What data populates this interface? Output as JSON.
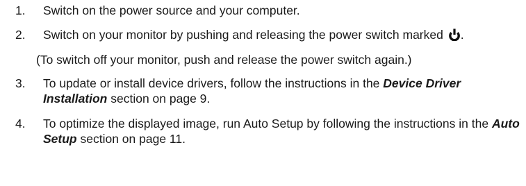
{
  "steps": [
    {
      "number": "1.",
      "text": "Switch on the power source and your computer."
    },
    {
      "number": "2.",
      "text_before_icon": "Switch on your monitor by pushing and releasing the power switch marked",
      "icon": "power-icon",
      "text_after_icon": "."
    },
    {
      "number": "3.",
      "text_before": "To update or install device drivers, follow the instructions in the ",
      "bold_italic": "Device Driver Installation",
      "text_after": " section on page 9."
    },
    {
      "number": "4.",
      "text_before": "To optimize the displayed image, run Auto Setup by following the instructions in the ",
      "bold_italic": "Auto Setup",
      "text_after": " section on page 11."
    }
  ],
  "note": "(To switch off your monitor, push and release the power switch again.)"
}
